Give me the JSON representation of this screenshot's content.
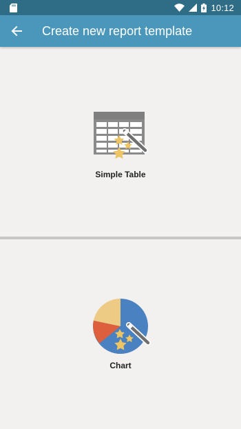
{
  "status_bar": {
    "time": "10:12",
    "icons": [
      "sd-card-icon",
      "wifi-icon",
      "signal-icon",
      "battery-charging-icon"
    ]
  },
  "app_bar": {
    "title": "Create new report template",
    "back_icon": "arrow-back-icon"
  },
  "options": [
    {
      "label": "Simple Table",
      "icon": "table-magic-wand-icon"
    },
    {
      "label": "Chart",
      "icon": "pie-chart-magic-wand-icon"
    }
  ],
  "colors": {
    "status_bar": "#2f6d86",
    "app_bar": "#4a97bb",
    "background": "#f2f1f0",
    "divider": "#c6c6c6",
    "table_icon": "#8a8a8a",
    "star": "#eec565",
    "pie_blue": "#4a82c1",
    "pie_yellow": "#eecb84",
    "pie_red": "#dd5f3e"
  }
}
